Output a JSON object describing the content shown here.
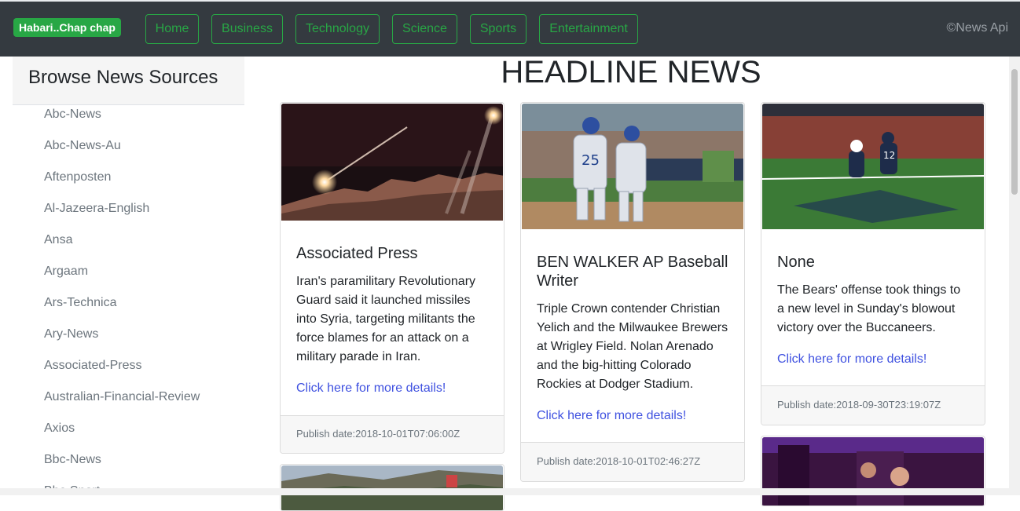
{
  "navbar": {
    "brand": "Habari..Chap chap",
    "links": [
      "Home",
      "Business",
      "Technology",
      "Science",
      "Sports",
      "Entertainment"
    ],
    "copyright": "©News Api",
    "colors": {
      "background": "#343a40",
      "accent": "#28a745"
    }
  },
  "sidebar": {
    "title": "Browse News Sources",
    "sources": [
      "Abc-News",
      "Abc-News-Au",
      "Aftenposten",
      "Al-Jazeera-English",
      "Ansa",
      "Argaam",
      "Ars-Technica",
      "Ary-News",
      "Associated-Press",
      "Australian-Financial-Review",
      "Axios",
      "Bbc-News",
      "Bbc-Sport"
    ]
  },
  "main": {
    "title": "HEADLINE NEWS",
    "cards": [
      {
        "image": "missiles-night-sky-image",
        "author": "Associated Press",
        "description": "Iran's paramilitary Revolutionary Guard said it launched missiles into Syria, targeting militants the force blames for an attack on a military parade in Iran.",
        "link": "Click here for more details!",
        "date": "Publish date:2018-10-01T07:06:00Z"
      },
      {
        "image": "baseball-players-image",
        "author": "BEN WALKER AP Baseball Writer",
        "description": "Triple Crown contender Christian Yelich and the Milwaukee Brewers at Wrigley Field. Nolan Arenado and the big-hitting Colorado Rockies at Dodger Stadium.",
        "link": "Click here for more details!",
        "date": "Publish date:2018-10-01T02:46:27Z"
      },
      {
        "image": "football-game-image",
        "author": "None",
        "description": "The Bears' offense took things to a new level in Sunday's blowout victory over the Buccaneers.",
        "link": "Click here for more details!",
        "date": "Publish date:2018-09-30T23:19:07Z"
      }
    ]
  }
}
